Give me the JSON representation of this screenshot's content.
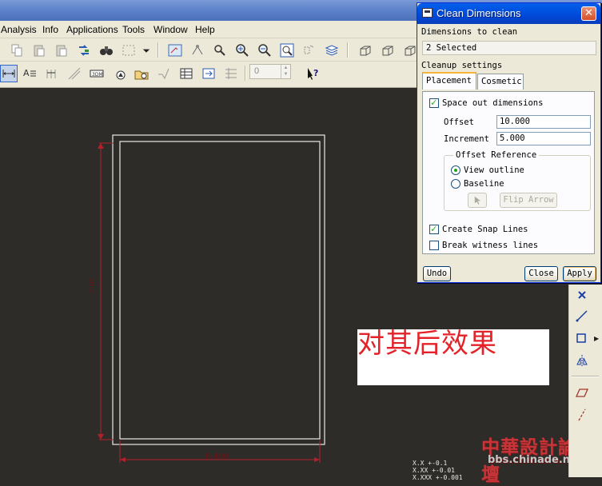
{
  "menubar": {
    "items": [
      "Analysis",
      "Info",
      "Applications",
      "Tools",
      "Window",
      "Help"
    ]
  },
  "toolbar": {
    "spinner_value": "0"
  },
  "canvas": {
    "annotation_text": "对其后效果",
    "dimension_vertical": "250",
    "dimension_horizontal": "8.400",
    "tolerance_lines": [
      "X.X  +-0.1",
      "X.XX  +-0.01",
      "X.XXX +-0.001"
    ]
  },
  "watermark": {
    "title": "中華設計論壇",
    "url": "bbs.chinade.net"
  },
  "dialog": {
    "title": "Clean Dimensions",
    "dimensions_label": "Dimensions to clean",
    "selected_value": "2 Selected",
    "cleanup_label": "Cleanup settings",
    "tabs": [
      "Placement",
      "Cosmetic"
    ],
    "space_out_label": "Space out dimensions",
    "offset_label": "Offset",
    "offset_value": "10.000",
    "increment_label": "Increment",
    "increment_value": "5.000",
    "offset_reference_label": "Offset Reference",
    "view_outline_label": "View outline",
    "baseline_label": "Baseline",
    "flip_arrow_label": "Flip Arrow",
    "create_snap_label": "Create Snap Lines",
    "break_witness_label": "Break witness lines",
    "undo_label": "Undo",
    "close_label": "Close",
    "apply_label": "Apply"
  },
  "colors": {
    "canvas_bg": "#2d2c29",
    "dimension": "#b3202a",
    "annotation_text": "#e4222a",
    "dialog_title": "#0145d4"
  }
}
